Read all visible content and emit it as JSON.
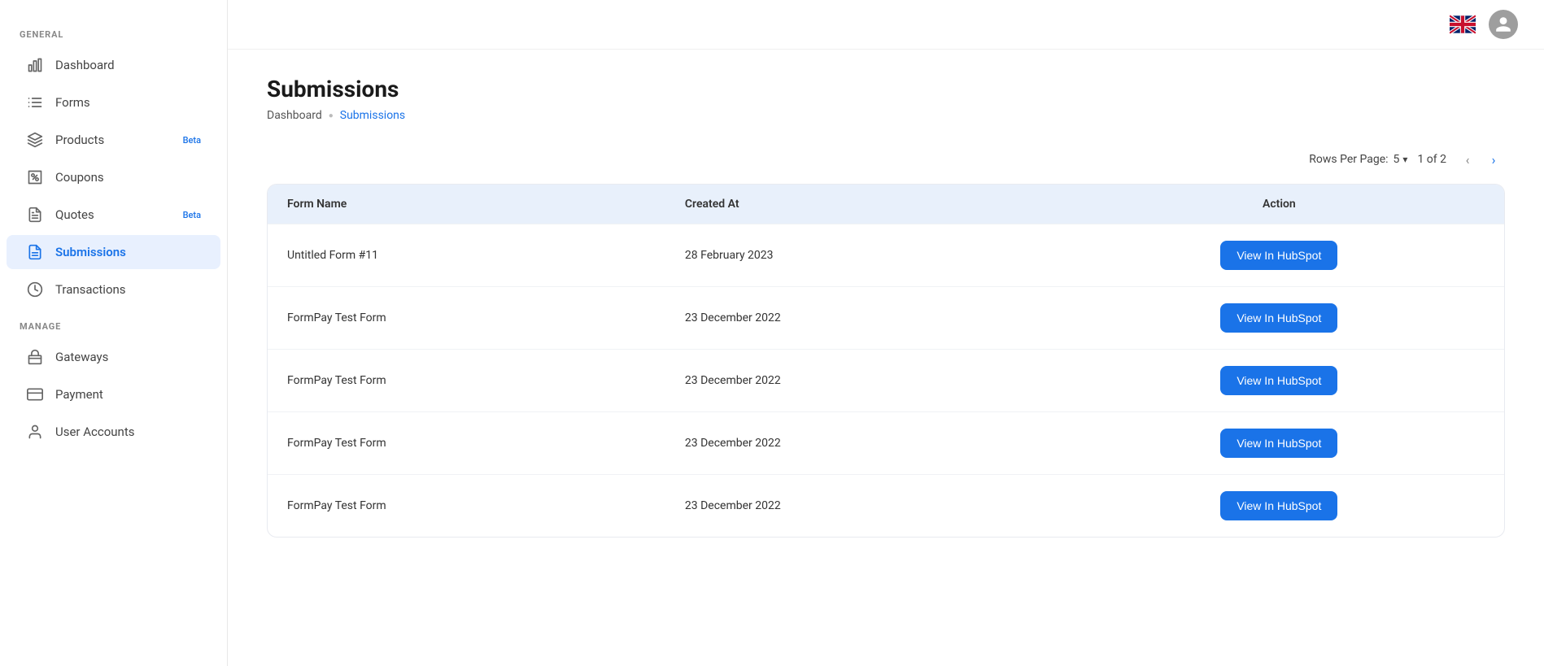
{
  "sidebar": {
    "general_label": "GENERAL",
    "manage_label": "MANAGE",
    "items_general": [
      {
        "id": "dashboard",
        "label": "Dashboard",
        "icon": "chart-icon",
        "active": false,
        "beta": ""
      },
      {
        "id": "forms",
        "label": "Forms",
        "icon": "forms-icon",
        "active": false,
        "beta": ""
      },
      {
        "id": "products",
        "label": "Products",
        "icon": "products-icon",
        "active": false,
        "beta": "Beta"
      },
      {
        "id": "coupons",
        "label": "Coupons",
        "icon": "coupons-icon",
        "active": false,
        "beta": ""
      },
      {
        "id": "quotes",
        "label": "Quotes",
        "icon": "quotes-icon",
        "active": false,
        "beta": "Beta"
      },
      {
        "id": "submissions",
        "label": "Submissions",
        "icon": "submissions-icon",
        "active": true,
        "beta": ""
      },
      {
        "id": "transactions",
        "label": "Transactions",
        "icon": "transactions-icon",
        "active": false,
        "beta": ""
      }
    ],
    "items_manage": [
      {
        "id": "gateways",
        "label": "Gateways",
        "icon": "gateways-icon",
        "active": false,
        "beta": ""
      },
      {
        "id": "payment",
        "label": "Payment",
        "icon": "payment-icon",
        "active": false,
        "beta": ""
      },
      {
        "id": "user-accounts",
        "label": "User Accounts",
        "icon": "user-accounts-icon",
        "active": false,
        "beta": ""
      }
    ]
  },
  "header": {
    "title": "Submissions",
    "breadcrumb_home": "Dashboard",
    "breadcrumb_current": "Submissions"
  },
  "pagination": {
    "rows_per_page_label": "Rows Per Page:",
    "rows_per_page_value": "5",
    "page_info": "1 of 2"
  },
  "table": {
    "columns": [
      {
        "id": "form_name",
        "label": "Form Name"
      },
      {
        "id": "created_at",
        "label": "Created At"
      },
      {
        "id": "action",
        "label": "Action"
      }
    ],
    "rows": [
      {
        "form_name": "Untitled Form #11",
        "created_at": "28 February 2023",
        "action_label": "View In HubSpot"
      },
      {
        "form_name": "FormPay Test Form",
        "created_at": "23 December 2022",
        "action_label": "View In HubSpot"
      },
      {
        "form_name": "FormPay Test Form",
        "created_at": "23 December 2022",
        "action_label": "View In HubSpot"
      },
      {
        "form_name": "FormPay Test Form",
        "created_at": "23 December 2022",
        "action_label": "View In HubSpot"
      },
      {
        "form_name": "FormPay Test Form",
        "created_at": "23 December 2022",
        "action_label": "View In HubSpot"
      }
    ]
  }
}
